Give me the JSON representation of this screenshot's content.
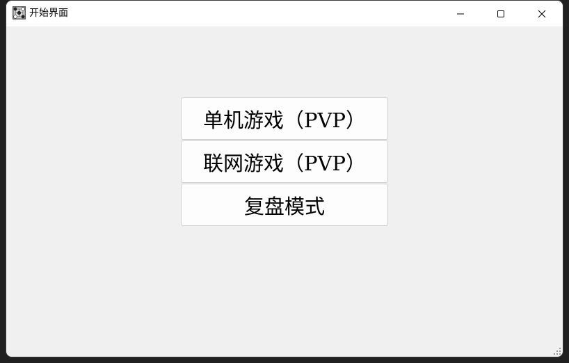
{
  "window": {
    "title": "开始界面",
    "icons": {
      "app": "go-board-icon",
      "minimize": "minimize-icon",
      "maximize": "maximize-icon",
      "close": "close-icon",
      "resize": "resize-grip-icon"
    }
  },
  "menu": {
    "buttons": [
      {
        "label": "单机游戏（PVP）"
      },
      {
        "label": "联网游戏（PVP）"
      },
      {
        "label": "复盘模式"
      }
    ]
  },
  "colors": {
    "titlebar": "#ffffff",
    "background": "#f0f0f0",
    "button": "#fdfdfd",
    "button_border": "#d0d0d0"
  }
}
